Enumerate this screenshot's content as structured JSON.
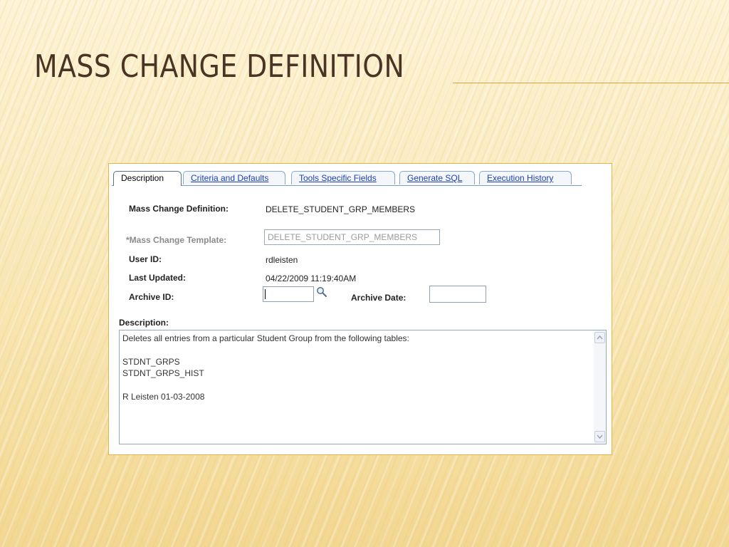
{
  "slide": {
    "title": "MASS CHANGE DEFINITION"
  },
  "tabs": [
    {
      "label": "Description",
      "active": true
    },
    {
      "label": "Criteria and Defaults",
      "active": false
    },
    {
      "label": "Tools Specific Fields",
      "active": false
    },
    {
      "label": "Generate SQL",
      "active": false
    },
    {
      "label": "Execution History",
      "active": false
    }
  ],
  "form": {
    "mass_change_definition": {
      "label": "Mass Change Definition:",
      "value": "DELETE_STUDENT_GRP_MEMBERS"
    },
    "mass_change_template": {
      "label": "*Mass Change Template:",
      "value": "DELETE_STUDENT_GRP_MEMBERS"
    },
    "user_id": {
      "label": "User ID:",
      "value": "rdleisten"
    },
    "last_updated": {
      "label": "Last Updated:",
      "value": "04/22/2009 11:19:40AM"
    },
    "archive_id": {
      "label": "Archive ID:",
      "value": ""
    },
    "archive_date": {
      "label": "Archive Date:",
      "value": ""
    },
    "description": {
      "label": "Description:",
      "lines": [
        "Deletes all entries from a particular Student Group from the following tables:",
        "",
        "STDNT_GRPS",
        "STDNT_GRPS_HIST",
        "",
        "R Leisten 01-03-2008"
      ]
    }
  },
  "icons": {
    "lookup": "magnifier-icon",
    "scroll_up": "chevron-up-icon",
    "scroll_down": "chevron-down-icon"
  },
  "colors": {
    "title": "#4a3424",
    "tab_link": "#1d3fb2",
    "frame_border": "#e6b24a"
  }
}
